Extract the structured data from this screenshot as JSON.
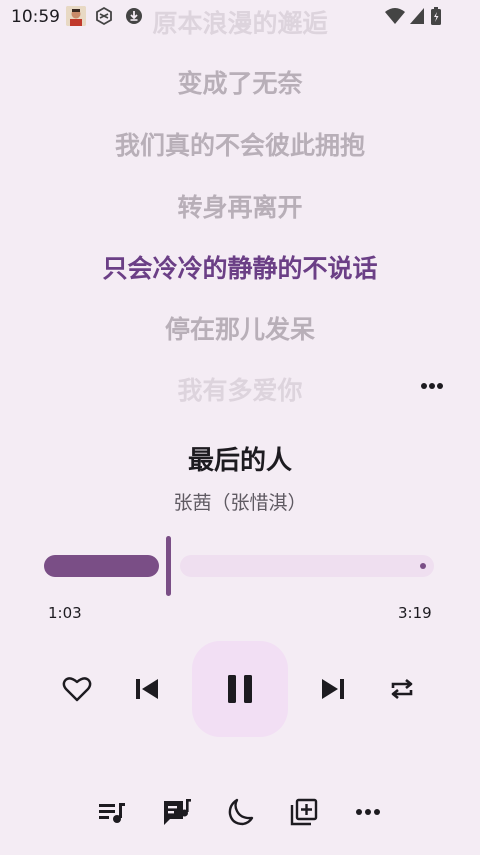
{
  "status_bar": {
    "time": "10:59",
    "icons": [
      "avatar-icon",
      "notification-app-icon",
      "download-icon",
      "wifi-icon",
      "signal-icon",
      "battery-icon"
    ]
  },
  "lyrics": {
    "lines": [
      "原本浪漫的邂逅",
      "变成了无奈",
      "我们真的不会彼此拥抱",
      "转身再离开",
      "只会冷冷的静静的不说话",
      "停在那儿发呆",
      "我有多爱你"
    ],
    "current_index": 4
  },
  "song": {
    "title": "最后的人",
    "artist": "张茜（张惜淇）"
  },
  "progress": {
    "elapsed": "1:03",
    "total": "3:19",
    "fraction": 0.316
  },
  "controls": {
    "buttons": [
      "heart-icon",
      "skip-previous-icon",
      "pause-icon",
      "skip-next-icon",
      "repeat-icon"
    ]
  },
  "bottom_bar": {
    "buttons": [
      "queue-music-icon",
      "lyrics-icon",
      "sleep-timer-icon",
      "add-to-playlist-icon",
      "more-icon"
    ]
  },
  "colors": {
    "background": "#f4ecf4",
    "accent": "#7a4e86",
    "current_lyric": "#6b3f86",
    "play_button_bg": "#f2dff4"
  }
}
